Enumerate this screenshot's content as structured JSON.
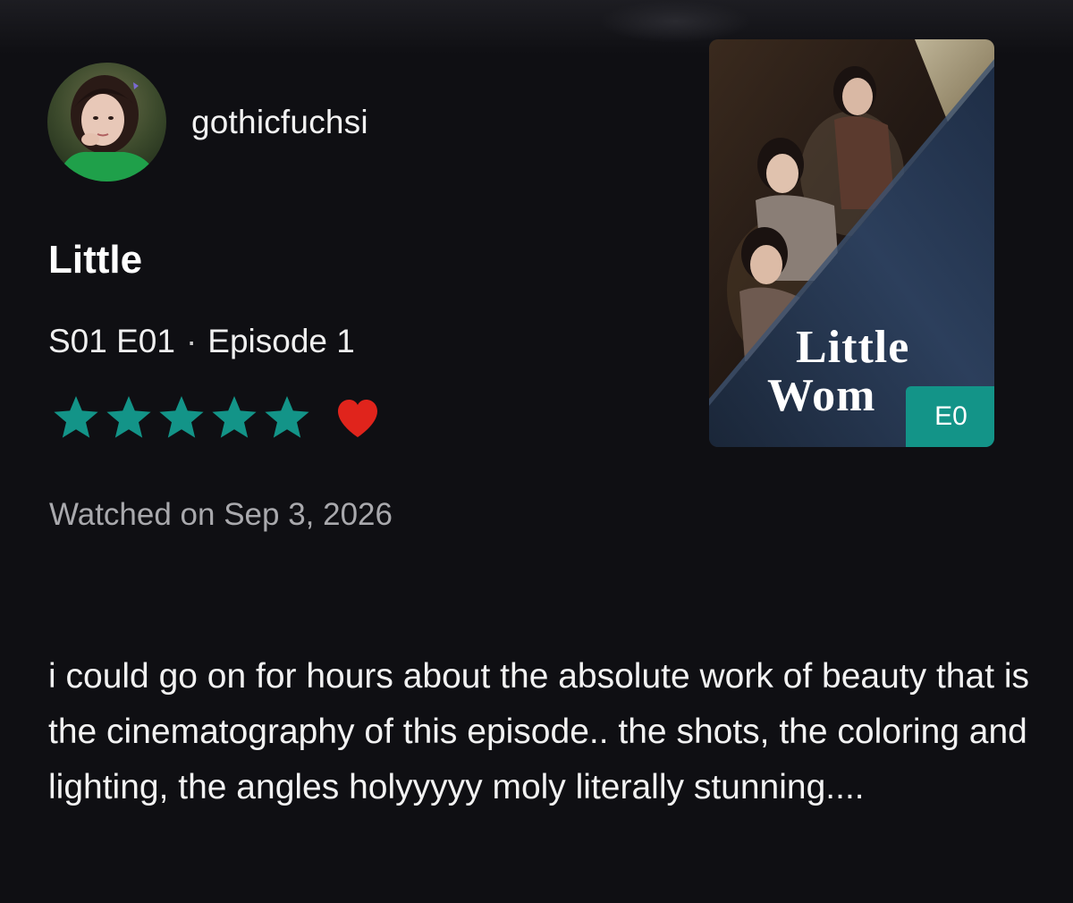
{
  "user": {
    "username": "gothicfuchsi",
    "avatar_icon": "user-avatar"
  },
  "show": {
    "title": "Little",
    "episode_code": "S01 E01",
    "separator": "·",
    "episode_name": "Episode 1"
  },
  "rating": {
    "stars": 5,
    "max_stars": 5,
    "star_color": "#139488",
    "liked": true,
    "heart_color": "#e0241c"
  },
  "watched_text": "Watched on Sep 3, 2026",
  "review_text": "i could go on for hours about the absolute work of beauty that is the cinematography of this episode.. the shots, the coloring and lighting, the angles holyyyyy moly literally stunning....",
  "poster": {
    "title_line1": "Little",
    "title_line2": "Wom",
    "badge": "E0",
    "badge_color": "#139488"
  },
  "colors": {
    "background": "#0f0f13",
    "muted_text": "#a9a9ad"
  }
}
